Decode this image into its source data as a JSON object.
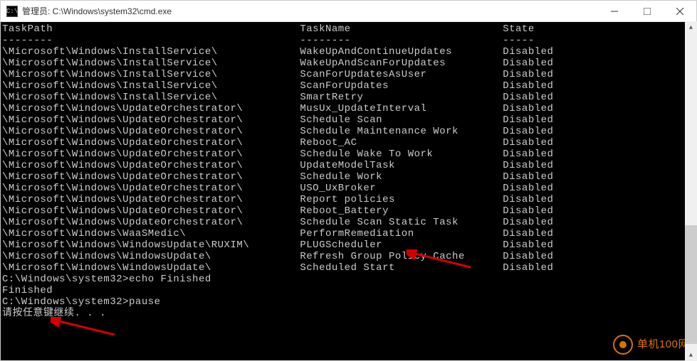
{
  "window": {
    "title": "管理员: C:\\Windows\\system32\\cmd.exe",
    "icon_label": "C:\\"
  },
  "headers": {
    "col1": "TaskPath",
    "col2": "TaskName",
    "col3": "State",
    "sep1": "--------",
    "sep2": "--------",
    "sep3": "-----"
  },
  "tasks": [
    {
      "path": "\\Microsoft\\Windows\\InstallService\\",
      "name": "WakeUpAndContinueUpdates",
      "state": "Disabled"
    },
    {
      "path": "\\Microsoft\\Windows\\InstallService\\",
      "name": "WakeUpAndScanForUpdates",
      "state": "Disabled"
    },
    {
      "path": "\\Microsoft\\Windows\\InstallService\\",
      "name": "ScanForUpdatesAsUser",
      "state": "Disabled"
    },
    {
      "path": "\\Microsoft\\Windows\\InstallService\\",
      "name": "ScanForUpdates",
      "state": "Disabled"
    },
    {
      "path": "\\Microsoft\\Windows\\InstallService\\",
      "name": "SmartRetry",
      "state": "Disabled"
    },
    {
      "path": "\\Microsoft\\Windows\\UpdateOrchestrator\\",
      "name": "MusUx_UpdateInterval",
      "state": "Disabled"
    },
    {
      "path": "\\Microsoft\\Windows\\UpdateOrchestrator\\",
      "name": "Schedule Scan",
      "state": "Disabled"
    },
    {
      "path": "\\Microsoft\\Windows\\UpdateOrchestrator\\",
      "name": "Schedule Maintenance Work",
      "state": "Disabled"
    },
    {
      "path": "\\Microsoft\\Windows\\UpdateOrchestrator\\",
      "name": "Reboot_AC",
      "state": "Disabled"
    },
    {
      "path": "\\Microsoft\\Windows\\UpdateOrchestrator\\",
      "name": "Schedule Wake To Work",
      "state": "Disabled"
    },
    {
      "path": "\\Microsoft\\Windows\\UpdateOrchestrator\\",
      "name": "UpdateModelTask",
      "state": "Disabled"
    },
    {
      "path": "\\Microsoft\\Windows\\UpdateOrchestrator\\",
      "name": "Schedule Work",
      "state": "Disabled"
    },
    {
      "path": "\\Microsoft\\Windows\\UpdateOrchestrator\\",
      "name": "USO_UxBroker",
      "state": "Disabled"
    },
    {
      "path": "\\Microsoft\\Windows\\UpdateOrchestrator\\",
      "name": "Report policies",
      "state": "Disabled"
    },
    {
      "path": "\\Microsoft\\Windows\\UpdateOrchestrator\\",
      "name": "Reboot_Battery",
      "state": "Disabled"
    },
    {
      "path": "\\Microsoft\\Windows\\UpdateOrchestrator\\",
      "name": "Schedule Scan Static Task",
      "state": "Disabled"
    },
    {
      "path": "\\Microsoft\\Windows\\WaaSMedic\\",
      "name": "PerformRemediation",
      "state": "Disabled"
    },
    {
      "path": "\\Microsoft\\Windows\\WindowsUpdate\\RUXIM\\",
      "name": "PLUGScheduler",
      "state": "Disabled"
    },
    {
      "path": "\\Microsoft\\Windows\\WindowsUpdate\\",
      "name": "Refresh Group Policy Cache",
      "state": "Disabled"
    },
    {
      "path": "\\Microsoft\\Windows\\WindowsUpdate\\",
      "name": "Scheduled Start",
      "state": "Disabled"
    }
  ],
  "commands": {
    "echo_line": "C:\\Windows\\system32>echo Finished",
    "finished": "Finished",
    "pause_line": "C:\\Windows\\system32>pause",
    "pause_msg": "请按任意键继续. . ."
  },
  "watermark": {
    "text": "单机100网"
  }
}
